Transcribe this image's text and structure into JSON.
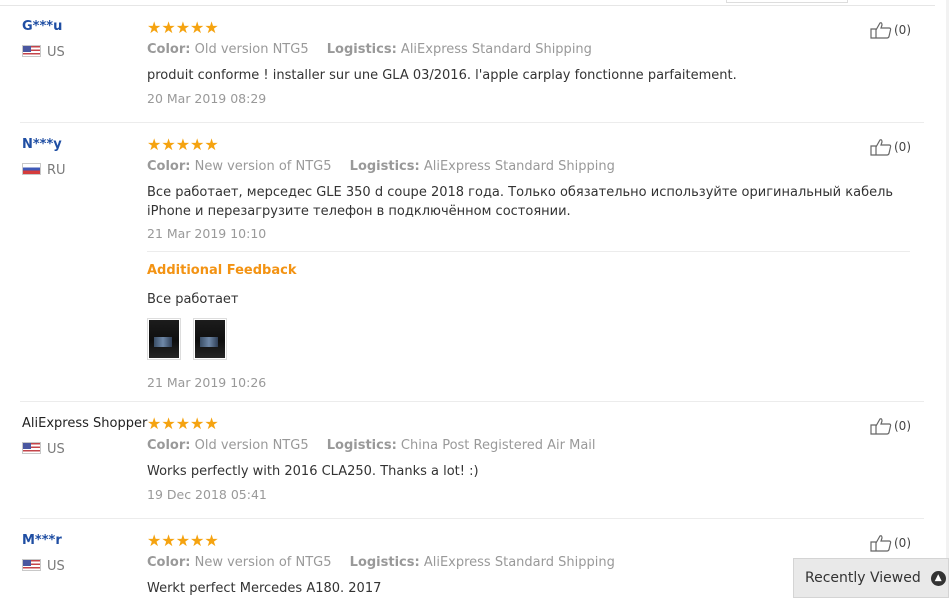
{
  "reviews": [
    {
      "user": "G***u",
      "country": "US",
      "flag": "us-flag-icon",
      "stars": "★★★★★",
      "color_label": "Color:",
      "color_value": "Old version NTG5",
      "logistics_label": "Logistics:",
      "logistics_value": "AliExpress Standard Shipping",
      "text": "produit conforme ! installer sur une GLA 03/2016. l'apple carplay fonctionne parfaitement.",
      "date": "20 Mar 2019 08:29",
      "likes": "(0)"
    },
    {
      "user": "N***y",
      "country": "RU",
      "flag": "ru-flag-icon",
      "stars": "★★★★★",
      "color_label": "Color:",
      "color_value": "New version of NTG5",
      "logistics_label": "Logistics:",
      "logistics_value": "AliExpress Standard Shipping",
      "text": "Все работает, мерседес GLE 350 d coupe 2018 года. Только обязательно используйте оригинальный кабель iPhone и перезагрузите телефон в подключённом состоянии.",
      "date": "21 Mar 2019 10:10",
      "likes": "(0)",
      "additional": {
        "title": "Additional Feedback",
        "text": "Все работает",
        "photos": [
          "review-photo-icon",
          "review-photo-icon"
        ],
        "date": "21 Mar 2019 10:26"
      }
    },
    {
      "user": "AliExpress Shopper",
      "country": "US",
      "flag": "us-flag-icon",
      "stars": "★★★★★",
      "color_label": "Color:",
      "color_value": "Old version NTG5",
      "logistics_label": "Logistics:",
      "logistics_value": "China Post Registered Air Mail",
      "text": "Works perfectly with 2016 CLA250. Thanks a lot! :)",
      "date": "19 Dec 2018 05:41",
      "likes": "(0)"
    },
    {
      "user": "M***r",
      "country": "US",
      "flag": "us-flag-icon",
      "stars": "★★★★★",
      "color_label": "Color:",
      "color_value": "New version of NTG5",
      "logistics_label": "Logistics:",
      "logistics_value": "AliExpress Standard Shipping",
      "text": "Werkt perfect Mercedes A180. 2017",
      "likes": "(0)"
    }
  ],
  "recently_viewed": {
    "label": "Recently Viewed",
    "icon": "chevron-up-icon"
  },
  "colors": {
    "star": "#f5a310",
    "username": "#1f4ea3",
    "additional_feedback": "#f39313",
    "muted": "#999999"
  }
}
